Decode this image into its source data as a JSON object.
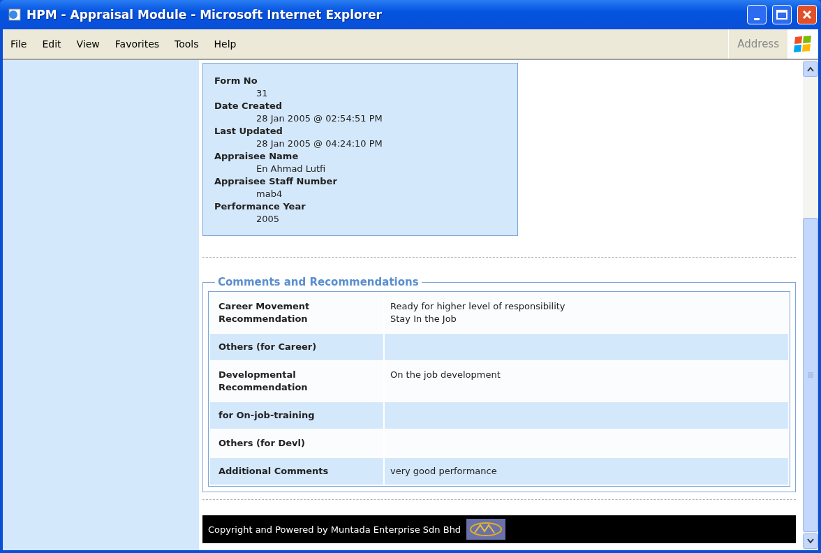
{
  "window": {
    "title": "HPM - Appraisal Module - Microsoft Internet Explorer"
  },
  "menu": [
    "File",
    "Edit",
    "View",
    "Favorites",
    "Tools",
    "Help"
  ],
  "address_label": "Address",
  "form_info": [
    {
      "label": "Form No",
      "value": "31"
    },
    {
      "label": "Date Created",
      "value": "28 Jan 2005 @ 02:54:51 PM"
    },
    {
      "label": "Last Updated",
      "value": "28 Jan 2005 @ 04:24:10 PM"
    },
    {
      "label": "Appraisee Name",
      "value": "En Ahmad Lutfi"
    },
    {
      "label": "Appraisee Staff Number",
      "value": "mab4"
    },
    {
      "label": "Performance Year",
      "value": "2005"
    }
  ],
  "comments": {
    "title": "Comments and Recommendations",
    "rows": [
      {
        "label": "Career Movement Recommendation",
        "values": [
          "Ready for higher level of responsibility",
          "Stay In the Job"
        ]
      },
      {
        "label": "Others (for Career)",
        "values": []
      },
      {
        "label": "Developmental Recommendation",
        "values": [
          "On the job development"
        ]
      },
      {
        "label": "for On-job-training",
        "values": []
      },
      {
        "label": "Others (for Devl)",
        "values": []
      },
      {
        "label": "Additional Comments",
        "values": [
          "very good performance"
        ]
      }
    ]
  },
  "footer": "Copyright and Powered by Muntada Enterprise Sdn Bhd"
}
